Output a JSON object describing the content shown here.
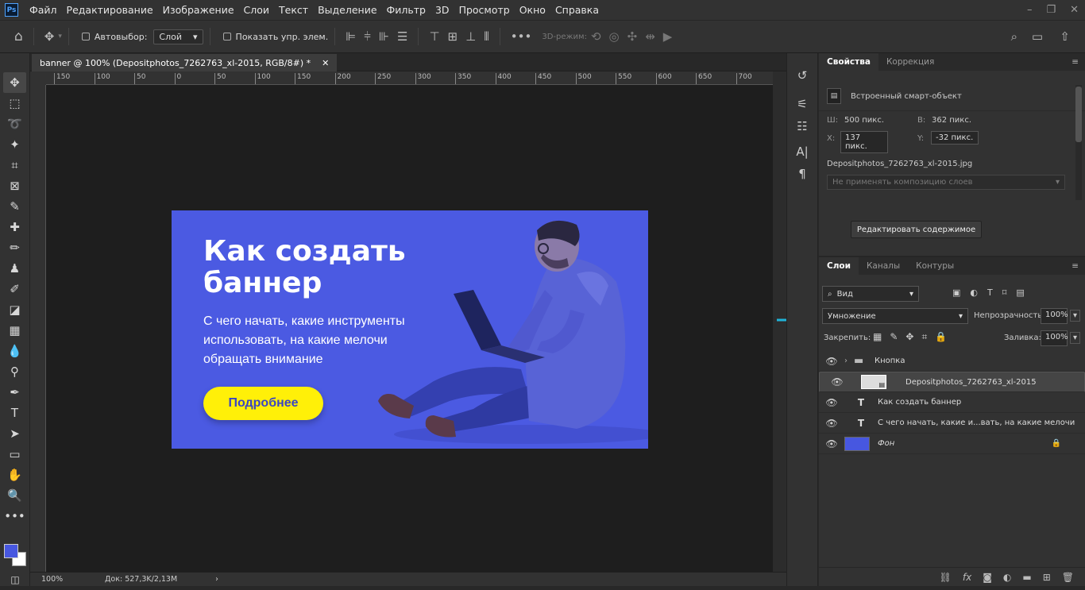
{
  "app": {
    "logo": "Ps"
  },
  "menu": [
    "Файл",
    "Редактирование",
    "Изображение",
    "Слои",
    "Текст",
    "Выделение",
    "Фильтр",
    "3D",
    "Просмотр",
    "Окно",
    "Справка"
  ],
  "window_controls": [
    "–",
    "❐",
    "✕"
  ],
  "options": {
    "autoselect_label": "Автовыбор:",
    "autoselect_value": "Слой",
    "show_transform_label": "Показать упр. элем.",
    "mode3d_label": "3D-режим:"
  },
  "document": {
    "tab_title": "banner @ 100% (Depositphotos_7262763_xl-2015, RGB/8#) *",
    "zoom": "100%",
    "doc_info": "Док: 527,3K/2,13M",
    "ruler_top": [
      "150",
      "100",
      "50",
      "0",
      "50",
      "100",
      "150",
      "200",
      "250",
      "300",
      "350",
      "400",
      "450",
      "500",
      "550",
      "600",
      "650",
      "700",
      "7"
    ]
  },
  "banner": {
    "title_line1": "Как создать",
    "title_line2": "баннер",
    "subtitle_line1": "С чего начать, какие инструменты",
    "subtitle_line2": "использовать, на какие мелочи",
    "subtitle_line3": "обращать внимание",
    "button": "Подробнее",
    "bg_color": "#4b5ae2",
    "button_color": "#fff008"
  },
  "properties": {
    "tabs": [
      "Свойства",
      "Коррекция"
    ],
    "object_type": "Встроенный смарт-объект",
    "w_label": "Ш:",
    "w_value": "500 пикс.",
    "h_label": "В:",
    "h_value": "362 пикс.",
    "x_label": "X:",
    "x_value": "137 пикс.",
    "y_label": "Y:",
    "y_value": "-32 пикс.",
    "filename": "Depositphotos_7262763_xl-2015.jpg",
    "comp_select": "Не применять композицию слоев",
    "edit_button": "Редактировать содержимое"
  },
  "layers_panel": {
    "tabs": [
      "Слои",
      "Каналы",
      "Контуры"
    ],
    "filter_value": "Вид",
    "blend_mode": "Умножение",
    "opacity_label": "Непрозрачность:",
    "opacity_value": "100%",
    "lock_label": "Закрепить:",
    "fill_label": "Заливка:",
    "fill_value": "100%",
    "layers": [
      {
        "name": "Кнопка",
        "type": "group"
      },
      {
        "name": "Depositphotos_7262763_xl-2015",
        "type": "smart"
      },
      {
        "name": "Как создать баннер",
        "type": "text"
      },
      {
        "name": "С чего начать, какие и...вать, на какие мелочи",
        "type": "text"
      },
      {
        "name": "Фон",
        "type": "fill"
      }
    ]
  },
  "colors": {
    "foreground": "#4757e0",
    "background": "#ffffff",
    "accent_arrow": "#1fb3d8"
  }
}
